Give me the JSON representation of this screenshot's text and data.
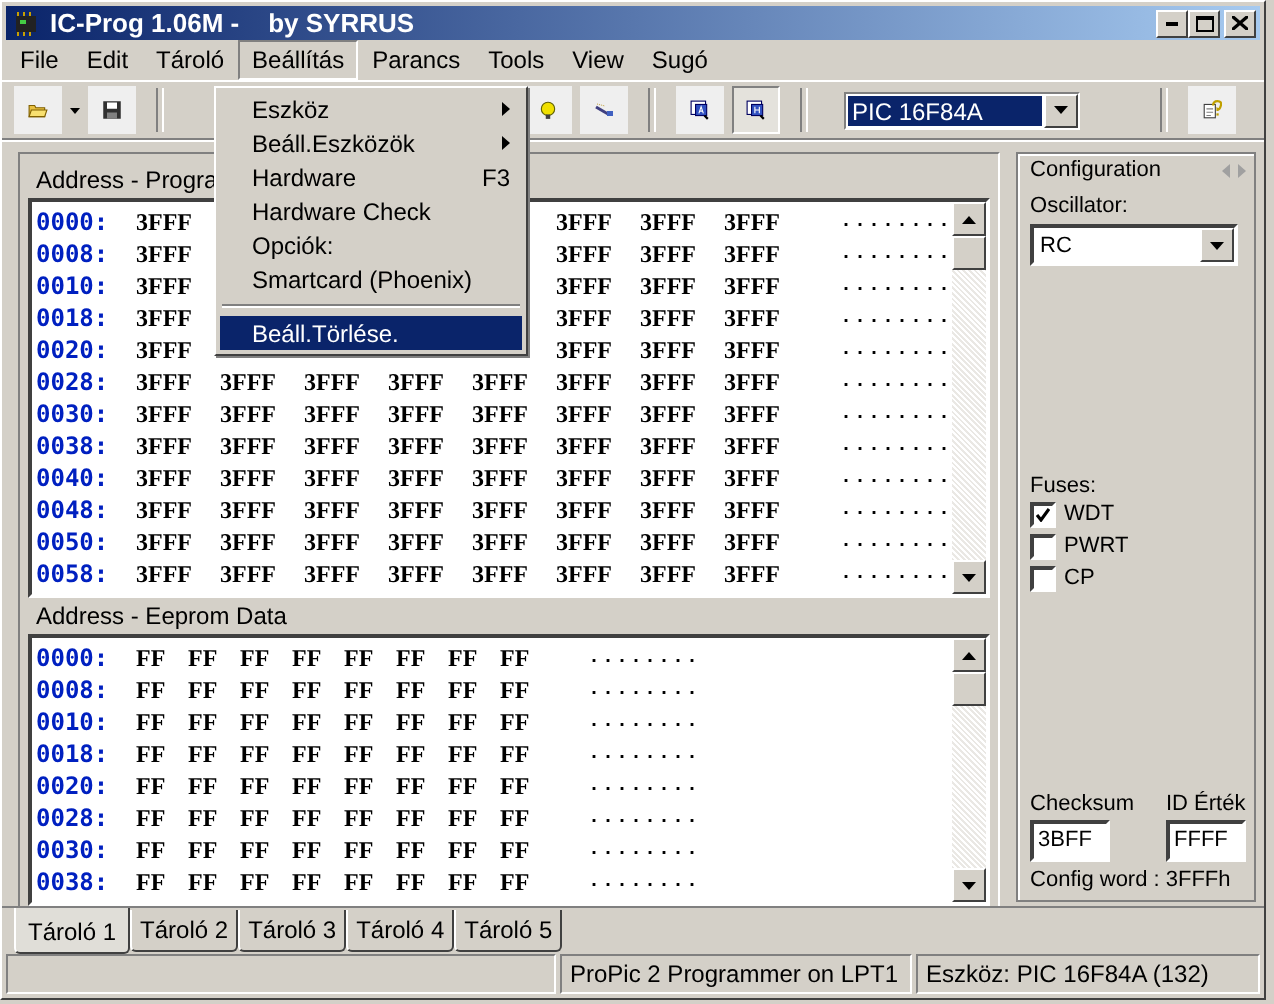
{
  "window": {
    "title": "IC-Prog 1.06M -    by SYRRUS"
  },
  "menu_bar": [
    {
      "label": "File",
      "selected": false
    },
    {
      "label": "Edit",
      "selected": false
    },
    {
      "label": "Tároló",
      "selected": false
    },
    {
      "label": "Beállítás",
      "selected": true
    },
    {
      "label": "Parancs",
      "selected": false
    },
    {
      "label": "Tools",
      "selected": false
    },
    {
      "label": "View",
      "selected": false
    },
    {
      "label": "Sugó",
      "selected": false
    }
  ],
  "open_menu": {
    "items": [
      {
        "kind": "item",
        "label": "Eszköz",
        "submenu": true,
        "selected": false
      },
      {
        "kind": "item",
        "label": "Beáll.Eszközök",
        "submenu": true,
        "selected": false
      },
      {
        "kind": "item",
        "label": "Hardware",
        "shortcut": "F3",
        "selected": false
      },
      {
        "kind": "item",
        "label": "Hardware Check",
        "selected": false
      },
      {
        "kind": "item",
        "label": "Opciók:",
        "selected": false
      },
      {
        "kind": "item",
        "label": "Smartcard (Phoenix)",
        "selected": false
      },
      {
        "kind": "separator"
      },
      {
        "kind": "item",
        "label": "Beáll.Törlése.",
        "selected": true
      }
    ]
  },
  "toolbar": {
    "view_buttons": [
      {
        "selected": false
      },
      {
        "selected": true
      }
    ],
    "device_select": {
      "value": "PIC 16F84A"
    }
  },
  "program": {
    "title": "Address - Progra",
    "rows": [
      {
        "address": "0000:",
        "cells": [
          "3FFF",
          null,
          null,
          null,
          null,
          "3FFF",
          "3FFF",
          "3FFF"
        ],
        "ascii": "........"
      },
      {
        "address": "0008:",
        "cells": [
          "3FFF",
          null,
          null,
          null,
          null,
          "3FFF",
          "3FFF",
          "3FFF"
        ],
        "ascii": "........"
      },
      {
        "address": "0010:",
        "cells": [
          "3FFF",
          null,
          null,
          null,
          null,
          "3FFF",
          "3FFF",
          "3FFF"
        ],
        "ascii": "........"
      },
      {
        "address": "0018:",
        "cells": [
          "3FFF",
          null,
          null,
          null,
          null,
          "3FFF",
          "3FFF",
          "3FFF"
        ],
        "ascii": "........"
      },
      {
        "address": "0020:",
        "cells": [
          "3FFF",
          null,
          null,
          null,
          null,
          "3FFF",
          "3FFF",
          "3FFF"
        ],
        "ascii": "........"
      },
      {
        "address": "0028:",
        "cells": [
          "3FFF",
          "3FFF",
          "3FFF",
          "3FFF",
          "3FFF",
          "3FFF",
          "3FFF",
          "3FFF"
        ],
        "ascii": "........"
      },
      {
        "address": "0030:",
        "cells": [
          "3FFF",
          "3FFF",
          "3FFF",
          "3FFF",
          "3FFF",
          "3FFF",
          "3FFF",
          "3FFF"
        ],
        "ascii": "........"
      },
      {
        "address": "0038:",
        "cells": [
          "3FFF",
          "3FFF",
          "3FFF",
          "3FFF",
          "3FFF",
          "3FFF",
          "3FFF",
          "3FFF"
        ],
        "ascii": "........"
      },
      {
        "address": "0040:",
        "cells": [
          "3FFF",
          "3FFF",
          "3FFF",
          "3FFF",
          "3FFF",
          "3FFF",
          "3FFF",
          "3FFF"
        ],
        "ascii": "........"
      },
      {
        "address": "0048:",
        "cells": [
          "3FFF",
          "3FFF",
          "3FFF",
          "3FFF",
          "3FFF",
          "3FFF",
          "3FFF",
          "3FFF"
        ],
        "ascii": "........"
      },
      {
        "address": "0050:",
        "cells": [
          "3FFF",
          "3FFF",
          "3FFF",
          "3FFF",
          "3FFF",
          "3FFF",
          "3FFF",
          "3FFF"
        ],
        "ascii": "........"
      },
      {
        "address": "0058:",
        "cells": [
          "3FFF",
          "3FFF",
          "3FFF",
          "3FFF",
          "3FFF",
          "3FFF",
          "3FFF",
          "3FFF"
        ],
        "ascii": "........"
      }
    ]
  },
  "eeprom": {
    "title": "Address - Eeprom Data",
    "rows": [
      {
        "address": "0000:",
        "cells": [
          "FF",
          "FF",
          "FF",
          "FF",
          "FF",
          "FF",
          "FF",
          "FF"
        ],
        "ascii": "........"
      },
      {
        "address": "0008:",
        "cells": [
          "FF",
          "FF",
          "FF",
          "FF",
          "FF",
          "FF",
          "FF",
          "FF"
        ],
        "ascii": "........"
      },
      {
        "address": "0010:",
        "cells": [
          "FF",
          "FF",
          "FF",
          "FF",
          "FF",
          "FF",
          "FF",
          "FF"
        ],
        "ascii": "........"
      },
      {
        "address": "0018:",
        "cells": [
          "FF",
          "FF",
          "FF",
          "FF",
          "FF",
          "FF",
          "FF",
          "FF"
        ],
        "ascii": "........"
      },
      {
        "address": "0020:",
        "cells": [
          "FF",
          "FF",
          "FF",
          "FF",
          "FF",
          "FF",
          "FF",
          "FF"
        ],
        "ascii": "........"
      },
      {
        "address": "0028:",
        "cells": [
          "FF",
          "FF",
          "FF",
          "FF",
          "FF",
          "FF",
          "FF",
          "FF"
        ],
        "ascii": "........"
      },
      {
        "address": "0030:",
        "cells": [
          "FF",
          "FF",
          "FF",
          "FF",
          "FF",
          "FF",
          "FF",
          "FF"
        ],
        "ascii": "........"
      },
      {
        "address": "0038:",
        "cells": [
          "FF",
          "FF",
          "FF",
          "FF",
          "FF",
          "FF",
          "FF",
          "FF"
        ],
        "ascii": "........"
      }
    ]
  },
  "configuration": {
    "title": "Configuration",
    "oscillator": {
      "label": "Oscillator:",
      "value": "RC"
    },
    "fuses": {
      "label": "Fuses:",
      "items": [
        {
          "label": "WDT",
          "checked": true
        },
        {
          "label": "PWRT",
          "checked": false
        },
        {
          "label": "CP",
          "checked": false
        }
      ]
    },
    "checksum": {
      "label": "Checksum",
      "value": "3BFF"
    },
    "id": {
      "label": "ID Érték",
      "value": "FFFF"
    },
    "config_word": "Config word : 3FFFh"
  },
  "tabs": [
    {
      "label": "Tároló 1",
      "selected": true
    },
    {
      "label": "Tároló 2",
      "selected": false
    },
    {
      "label": "Tároló 3",
      "selected": false
    },
    {
      "label": "Tároló 4",
      "selected": false
    },
    {
      "label": "Tároló 5",
      "selected": false
    }
  ],
  "status_bar": {
    "panels": [
      "ProPic 2 Programmer on LPT1",
      "Eszköz: PIC 16F84A  (132)"
    ]
  }
}
